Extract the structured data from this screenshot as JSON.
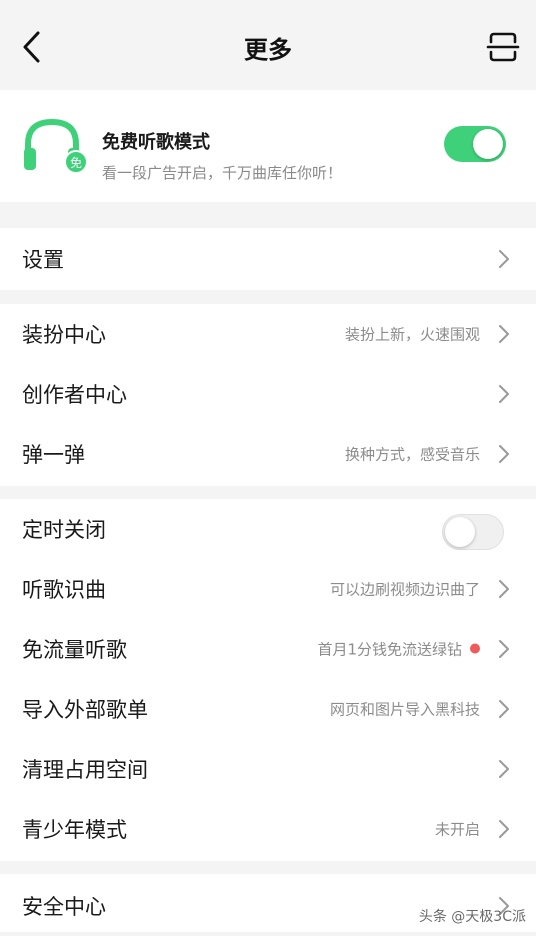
{
  "header": {
    "title": "更多"
  },
  "free_mode": {
    "title": "免费听歌模式",
    "subtitle": "看一段广告开启，千万曲库任你听！",
    "badge": "免",
    "enabled": true
  },
  "sections": [
    {
      "items": [
        {
          "label": "设置",
          "value": ""
        }
      ]
    },
    {
      "items": [
        {
          "label": "装扮中心",
          "value": "装扮上新，火速围观"
        },
        {
          "label": "创作者中心",
          "value": ""
        },
        {
          "label": "弹一弹",
          "value": "换种方式，感受音乐"
        }
      ]
    },
    {
      "items": [
        {
          "label": "定时关闭",
          "toggle": false
        },
        {
          "label": "听歌识曲",
          "value": "可以边刷视频边识曲了"
        },
        {
          "label": "免流量听歌",
          "value": "首月1分钱免流送绿钻"
        },
        {
          "label": "导入外部歌单",
          "value": "网页和图片导入黑科技"
        },
        {
          "label": "清理占用空间",
          "value": ""
        },
        {
          "label": "青少年模式",
          "value": "未开启"
        }
      ]
    },
    {
      "items": [
        {
          "label": "安全中心",
          "value": ""
        }
      ]
    }
  ],
  "watermark": "头条 @天极3C派",
  "colors": {
    "accent": "#3fd17a",
    "dot": "#f05a5a"
  },
  "icons": [
    "back-arrow-icon",
    "scan-icon",
    "headphones-icon",
    "chevron-right-icon"
  ]
}
